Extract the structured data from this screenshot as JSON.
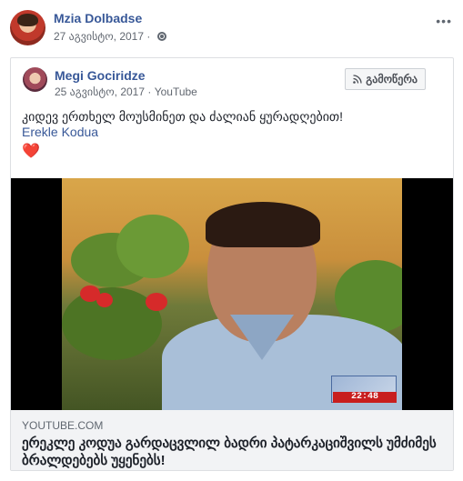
{
  "post": {
    "author": "Mzia Dolbadse",
    "date": "27 აგვისტო, 2017 ·",
    "more": "•••"
  },
  "shared": {
    "author": "Megi Gociridze",
    "meta": "25 აგვისტო, 2017 · YouTube",
    "subscribe_label": "გამოწერა",
    "text": "კიდევ ერთხელ მოუსმინეთ და ძალიან ყურადღებით!",
    "mention": "Erekle Kodua",
    "emoji": "❤️"
  },
  "video": {
    "clock": "22:48"
  },
  "link": {
    "domain": "YOUTUBE.COM",
    "title": "ერეკლე კოდუა გარდაცვლილ ბადრი პატარკაციშვილს უმძიმეს ბრალდებებს უყენებს!"
  },
  "icons": {
    "privacy": "globe-icon",
    "subscribe": "rss-icon"
  }
}
